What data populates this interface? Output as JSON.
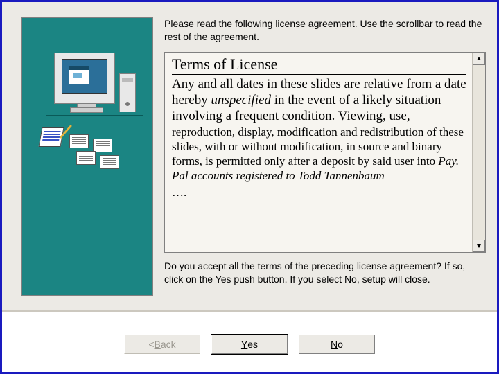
{
  "intro": "Please read the following license agreement. Use the scrollbar to read the rest of the agreement.",
  "license": {
    "title": "Terms of License",
    "body1_pre": "Any and all dates in these slides ",
    "body1_u1": "are relative from a date",
    "body1_mid1": " hereby ",
    "body1_i1": "unspecified",
    "body1_post": " in the event of a likely situation involving a frequent condition. Viewing, use,",
    "body2_pre": "reproduction, display, modification and redistribution of these slides, with or without modification, in source and binary forms, is permitted ",
    "body2_u1": "only after a deposit by said user",
    "body2_mid": " into ",
    "body2_i1": "Pay. Pal accounts registered to Todd Tannenbaum",
    "ellipsis": "…."
  },
  "accept": "Do you accept all the terms of the preceding license agreement? If so, click on the Yes push button. If you select No, setup will close.",
  "buttons": {
    "back_prefix": "< ",
    "back_letter": "B",
    "back_rest": "ack",
    "yes_letter": "Y",
    "yes_rest": "es",
    "no_letter": "N",
    "no_rest": "o"
  }
}
